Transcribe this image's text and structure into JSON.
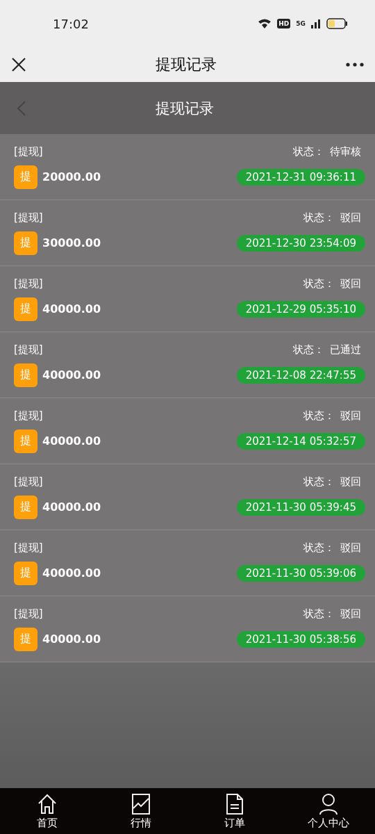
{
  "status_bar": {
    "time": "17:02",
    "hd": "HD",
    "network": "5G"
  },
  "browser_bar": {
    "title": "提现记录"
  },
  "header": {
    "title": "提现记录"
  },
  "records": [
    {
      "type": "[提现]",
      "status_label": "状态：",
      "status": "待审核",
      "badge": "提",
      "amount": "20000.00",
      "time": "2021-12-31 09:36:11"
    },
    {
      "type": "[提现]",
      "status_label": "状态：",
      "status": "驳回",
      "badge": "提",
      "amount": "30000.00",
      "time": "2021-12-30 23:54:09"
    },
    {
      "type": "[提现]",
      "status_label": "状态：",
      "status": "驳回",
      "badge": "提",
      "amount": "40000.00",
      "time": "2021-12-29 05:35:10"
    },
    {
      "type": "[提现]",
      "status_label": "状态：",
      "status": "已通过",
      "badge": "提",
      "amount": "40000.00",
      "time": "2021-12-08 22:47:55"
    },
    {
      "type": "[提现]",
      "status_label": "状态：",
      "status": "驳回",
      "badge": "提",
      "amount": "40000.00",
      "time": "2021-12-14 05:32:57"
    },
    {
      "type": "[提现]",
      "status_label": "状态：",
      "status": "驳回",
      "badge": "提",
      "amount": "40000.00",
      "time": "2021-11-30 05:39:45"
    },
    {
      "type": "[提现]",
      "status_label": "状态：",
      "status": "驳回",
      "badge": "提",
      "amount": "40000.00",
      "time": "2021-11-30 05:39:06"
    },
    {
      "type": "[提现]",
      "status_label": "状态：",
      "status": "驳回",
      "badge": "提",
      "amount": "40000.00",
      "time": "2021-11-30 05:38:56"
    }
  ],
  "tab_bar": [
    {
      "kind": "home",
      "label": "首页"
    },
    {
      "kind": "market",
      "label": "行情"
    },
    {
      "kind": "orders",
      "label": "订单"
    },
    {
      "kind": "profile",
      "label": "个人中心"
    }
  ]
}
